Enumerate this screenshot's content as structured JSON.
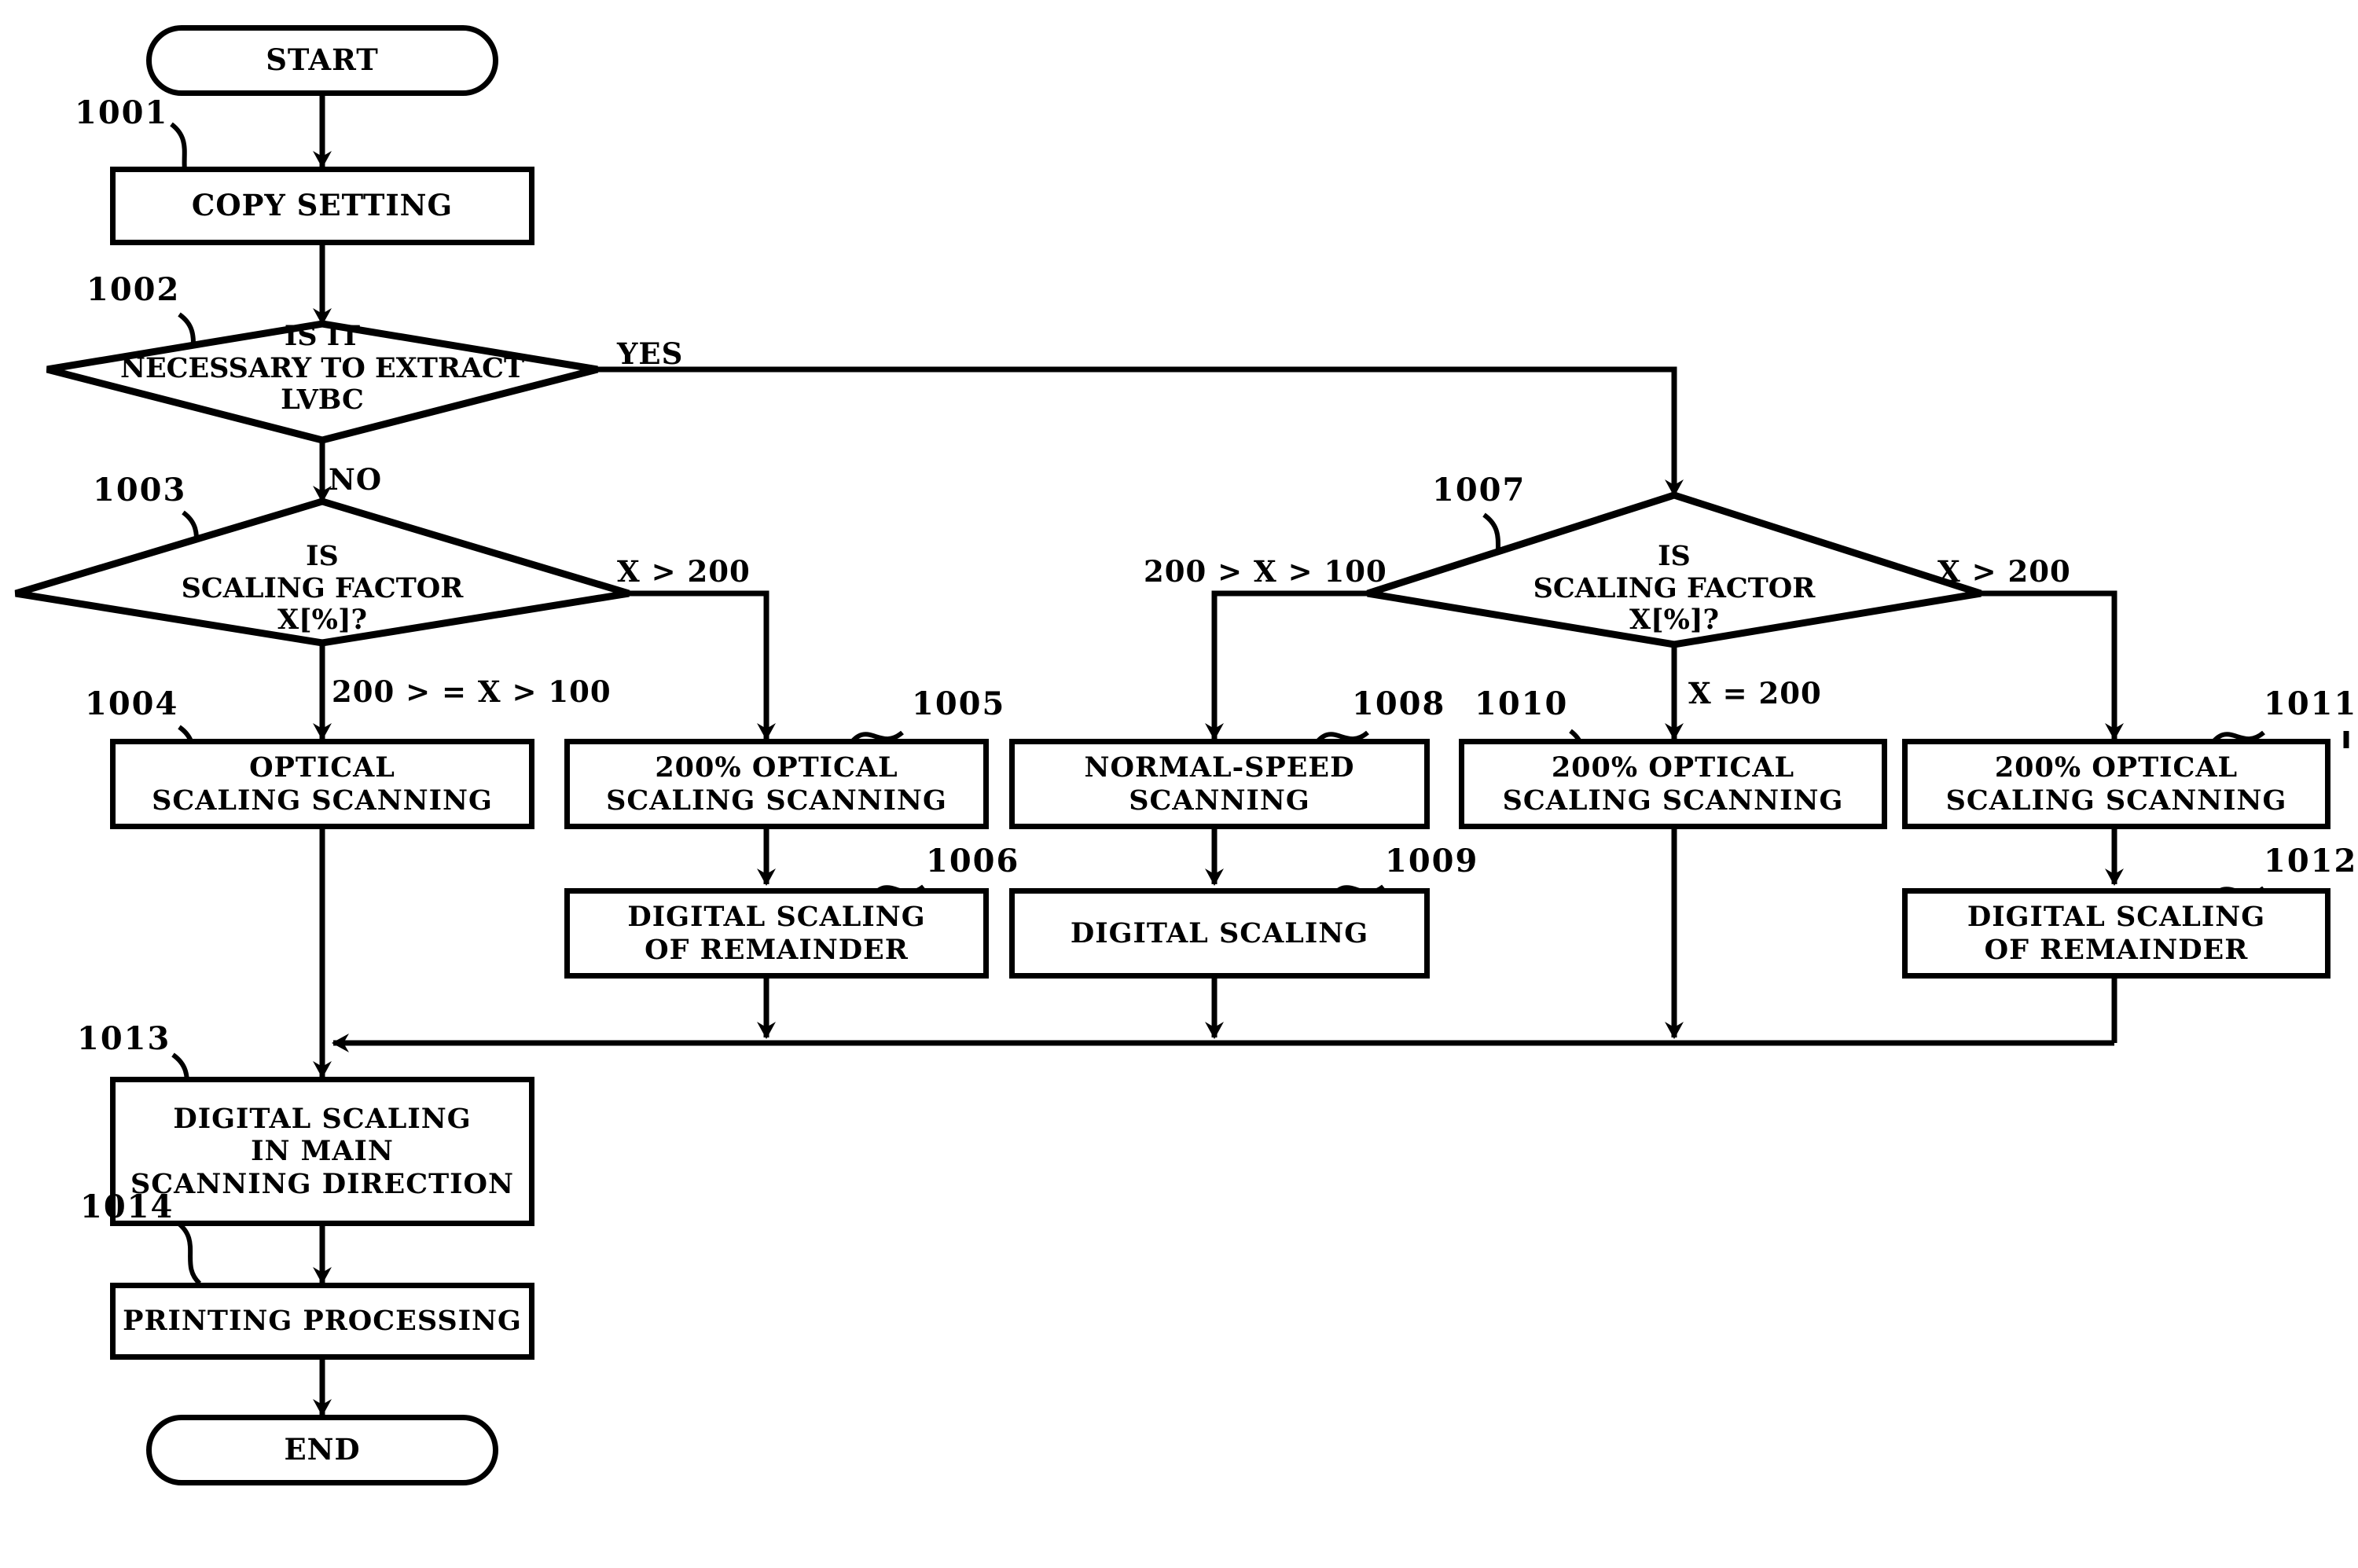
{
  "figure": {
    "type": "flowchart",
    "orientation": "top-to-bottom",
    "background_color": "#ffffff",
    "line_color": "#000000"
  },
  "terminators": {
    "start": {
      "label": "START",
      "ref": ""
    },
    "end": {
      "label": "END",
      "ref": ""
    }
  },
  "nodes": [
    {
      "id": "1001",
      "ref": "1001",
      "shape": "process",
      "label": "COPY SETTING"
    },
    {
      "id": "1002",
      "ref": "1002",
      "shape": "decision",
      "label": "IS IT\nNECESSARY TO EXTRACT\nLVBC"
    },
    {
      "id": "1003",
      "ref": "1003",
      "shape": "decision",
      "label": "IS\nSCALING FACTOR\nX[%]?"
    },
    {
      "id": "1004",
      "ref": "1004",
      "shape": "process",
      "label": "OPTICAL\nSCALING SCANNING"
    },
    {
      "id": "1005",
      "ref": "1005",
      "shape": "process",
      "label": "200% OPTICAL\nSCALING SCANNING"
    },
    {
      "id": "1006",
      "ref": "1006",
      "shape": "process",
      "label": "DIGITAL SCALING\nOF REMAINDER"
    },
    {
      "id": "1007",
      "ref": "1007",
      "shape": "decision",
      "label": "IS\nSCALING FACTOR\nX[%]?"
    },
    {
      "id": "1008",
      "ref": "1008",
      "shape": "process",
      "label": "NORMAL-SPEED\nSCANNING"
    },
    {
      "id": "1009",
      "ref": "1009",
      "shape": "process",
      "label": "DIGITAL SCALING"
    },
    {
      "id": "1010",
      "ref": "1010",
      "shape": "process",
      "label": "200% OPTICAL\nSCALING SCANNING"
    },
    {
      "id": "1011",
      "ref": "1011",
      "shape": "process",
      "label": "200% OPTICAL\nSCALING SCANNING"
    },
    {
      "id": "1012",
      "ref": "1012",
      "shape": "process",
      "label": "DIGITAL SCALING\nOF REMAINDER"
    },
    {
      "id": "1013",
      "ref": "1013",
      "shape": "process",
      "label": "DIGITAL SCALING\nIN MAIN\nSCANNING DIRECTION"
    },
    {
      "id": "1014",
      "ref": "1014",
      "shape": "process",
      "label": "PRINTING PROCESSING"
    }
  ],
  "edge_labels": {
    "yes_1002": "YES",
    "no_1002": "NO",
    "ge200_1003": "200 > = X > 100",
    "gt200_1003": "X > 200",
    "range_1007": "200 > X > 100",
    "eq200_1007": "X = 200",
    "gt200_1007": "X > 200"
  }
}
